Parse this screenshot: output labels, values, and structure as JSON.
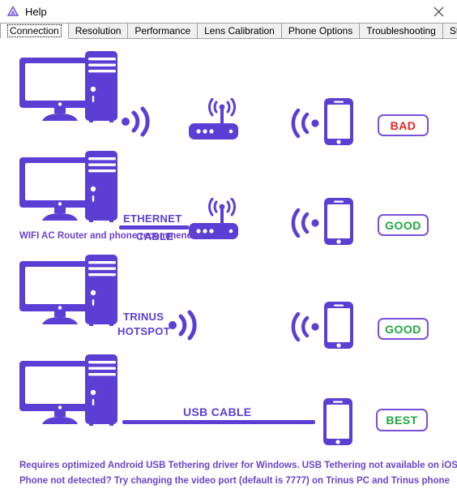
{
  "window": {
    "title": "Help",
    "title_icon": "trinus-triangle-logo-icon",
    "close_icon": "close-icon"
  },
  "tabs": [
    {
      "label": "Connection",
      "selected": true
    },
    {
      "label": "Resolution",
      "selected": false
    },
    {
      "label": "Performance",
      "selected": false
    },
    {
      "label": "Lens Calibration",
      "selected": false
    },
    {
      "label": "Phone Options",
      "selected": false
    },
    {
      "label": "Troubleshooting",
      "selected": false
    },
    {
      "label": "SteamVR",
      "selected": false
    }
  ],
  "colors": {
    "purple": "#5b3fd4",
    "purple_light": "#7b4fd8",
    "bad": "#e8241e",
    "good": "#1fa83c",
    "caption": "#6b43c9"
  },
  "diagram": {
    "rows": [
      {
        "id": "wifi-router",
        "left_icon": "desktop-pc-icon",
        "link_label": "",
        "mid_icon": "wifi-router-icon",
        "right_icon": "smartphone-icon",
        "rating": "BAD",
        "rating_kind": "bad",
        "caption": ""
      },
      {
        "id": "ethernet-router",
        "left_icon": "desktop-pc-icon",
        "link_label_line1": "ETHERNET",
        "link_label_line2": "CABLE",
        "mid_icon": "wifi-router-icon",
        "right_icon": "smartphone-icon",
        "rating": "GOOD",
        "rating_kind": "good",
        "caption": "WIFI AC Router and phone recommended"
      },
      {
        "id": "trinus-hotspot",
        "left_icon": "desktop-pc-icon",
        "link_label_line1": "TRINUS",
        "link_label_line2": "HOTSPOT",
        "mid_icon": "",
        "right_icon": "smartphone-icon",
        "rating": "GOOD",
        "rating_kind": "good",
        "caption": ""
      },
      {
        "id": "usb-cable",
        "left_icon": "desktop-pc-icon",
        "link_label": "USB CABLE",
        "mid_icon": "",
        "right_icon": "smartphone-icon",
        "rating": "BEST",
        "rating_kind": "best",
        "caption": ""
      }
    ],
    "footer_lines": [
      "Requires optimized Android USB Tethering driver for Windows. USB Tethering not available on iOS",
      "Phone not detected? Try changing the video port (default is 7777) on Trinus PC and Trinus phone"
    ]
  }
}
